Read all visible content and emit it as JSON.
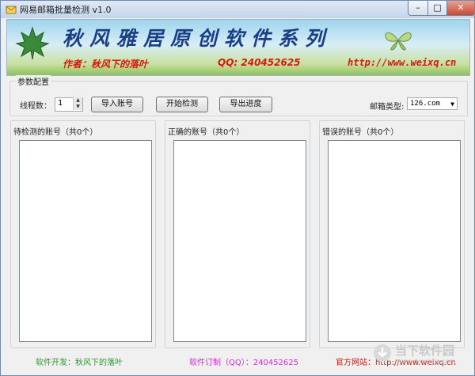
{
  "window": {
    "title": "网易邮箱批量检测 v1.0",
    "controls": {
      "minimize": "–",
      "maximize": "□",
      "close": "✕"
    }
  },
  "banner": {
    "title": "秋风雅居原创软件系列",
    "author": "作者：秋风下的落叶",
    "qq": "QQ: 240452625",
    "url": "http://www.weixq.cn"
  },
  "config": {
    "group_label": "参数配置",
    "threads_label": "线程数：",
    "threads_value": "1",
    "import_button": "导入账号",
    "start_button": "开始检测",
    "export_button": "导出进度",
    "mailbox_type_label": "邮箱类型:",
    "mailbox_type_value": "126.com"
  },
  "lists": {
    "pending_label": "待检测的账号（共0个）",
    "correct_label": "正确的账号（共0个）",
    "error_label": "错误的账号（共0个）"
  },
  "footer": {
    "developer": "软件开发：秋风下的落叶",
    "order": "软件订制（QQ）：240452625",
    "website": "官方网站：http://www.weixq.cn"
  },
  "watermark": {
    "text": "当下软件园",
    "url": "www.downxia.com"
  },
  "colors": {
    "banner_title": "#1a3f86",
    "banner_info": "#d61a0c",
    "footer_developer": "#2c9a2c",
    "footer_order": "#d62bd6",
    "footer_website": "#d61a0c"
  }
}
